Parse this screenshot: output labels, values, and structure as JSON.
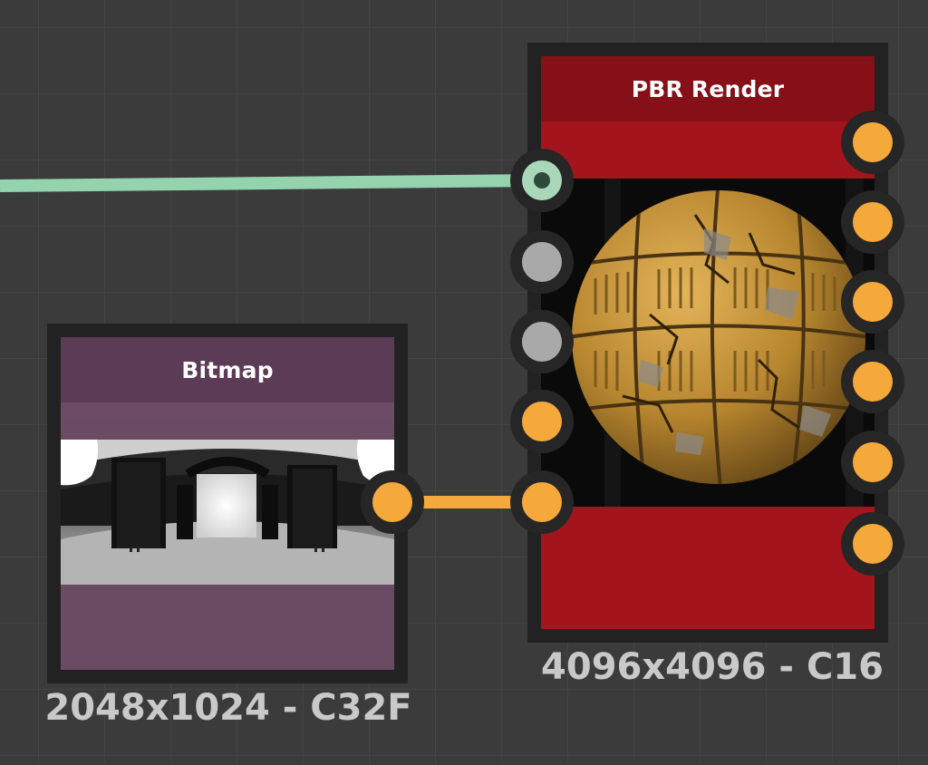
{
  "graph": {
    "nodes": {
      "bitmap": {
        "title": "Bitmap",
        "info": "2048x1024 - C32F",
        "header_color": "#5b3b55",
        "body_color": "#6b4a64",
        "preview": "hdri-environment-thumbnail"
      },
      "pbr_render": {
        "title": "PBR Render",
        "info": "4096x4096 - C16",
        "header_color": "#851018",
        "body_color": "#a3141c",
        "preview": "material-sphere-thumbnail",
        "input_ports": [
          {
            "color": "#a8d8b9",
            "state": "connected",
            "icon": "connected-socket-icon"
          },
          {
            "color": "#a9a9a9",
            "state": "empty"
          },
          {
            "color": "#a9a9a9",
            "state": "empty"
          },
          {
            "color": "#f6a93b",
            "state": "empty"
          },
          {
            "color": "#f6a93b",
            "state": "connected"
          }
        ],
        "output_ports": [
          {
            "color": "#f6a93b"
          },
          {
            "color": "#f6a93b"
          },
          {
            "color": "#f6a93b"
          },
          {
            "color": "#f6a93b"
          },
          {
            "color": "#f6a93b"
          },
          {
            "color": "#f6a93b"
          }
        ]
      }
    },
    "connections": [
      {
        "from": "offscreen-left",
        "to": "pbr_render.input.0",
        "color": "#94d3ad"
      },
      {
        "from": "bitmap.output",
        "to": "pbr_render.input.4",
        "color": "#f6a93b"
      }
    ],
    "colors": {
      "canvas": "#3b3b3b",
      "grid": "#444444",
      "port_ring": "#262626",
      "footer_text": "#c9c9c9"
    }
  }
}
